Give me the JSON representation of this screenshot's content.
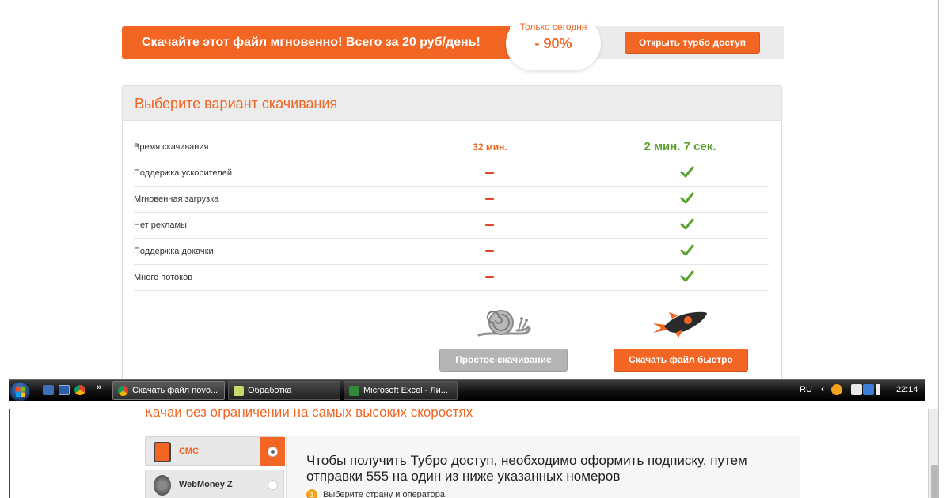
{
  "promo": {
    "text": "Скачайте этот файл мгновенно! Всего за 20 руб/день!",
    "badge_line1": "Только сегодня",
    "badge_line2": "- 90%",
    "turbo_button": "Открыть турбо доступ"
  },
  "panel": {
    "title": "Выберите вариант скачивания",
    "rows": [
      {
        "label": "Время скачивания",
        "slow": "32 мин.",
        "fast": "2 мин. 7 сек."
      },
      {
        "label": "Поддержка ускорителей"
      },
      {
        "label": "Мгновенная загрузка"
      },
      {
        "label": "Нет рекламы"
      },
      {
        "label": "Поддержка докачки"
      },
      {
        "label": "Много потоков"
      }
    ],
    "simple_button": "Простое скачивание",
    "fast_button": "Скачать файл быстро"
  },
  "taskbar": {
    "tasks": [
      {
        "label": "Скачать файл novo..."
      },
      {
        "label": "Обработка"
      },
      {
        "label": "Microsoft Excel - Ли..."
      }
    ],
    "lang": "RU",
    "clock": "22:14"
  },
  "bottom": {
    "title": "Качай без ограничений на самых высоких скоростях",
    "methods": [
      {
        "label": "СМС"
      },
      {
        "label": "WebMoney Z"
      }
    ],
    "info_text": "Чтобы получить Тубро доступ, необходимо оформить подписку, путем отправки 555 на один из ниже указанных номеров",
    "step_number": "1",
    "step_text": "Выберите страну и оператора"
  },
  "colors": {
    "accent": "#f26522",
    "success": "#5aa02c",
    "dash": "#e8432a",
    "taskbar": "#111111"
  }
}
